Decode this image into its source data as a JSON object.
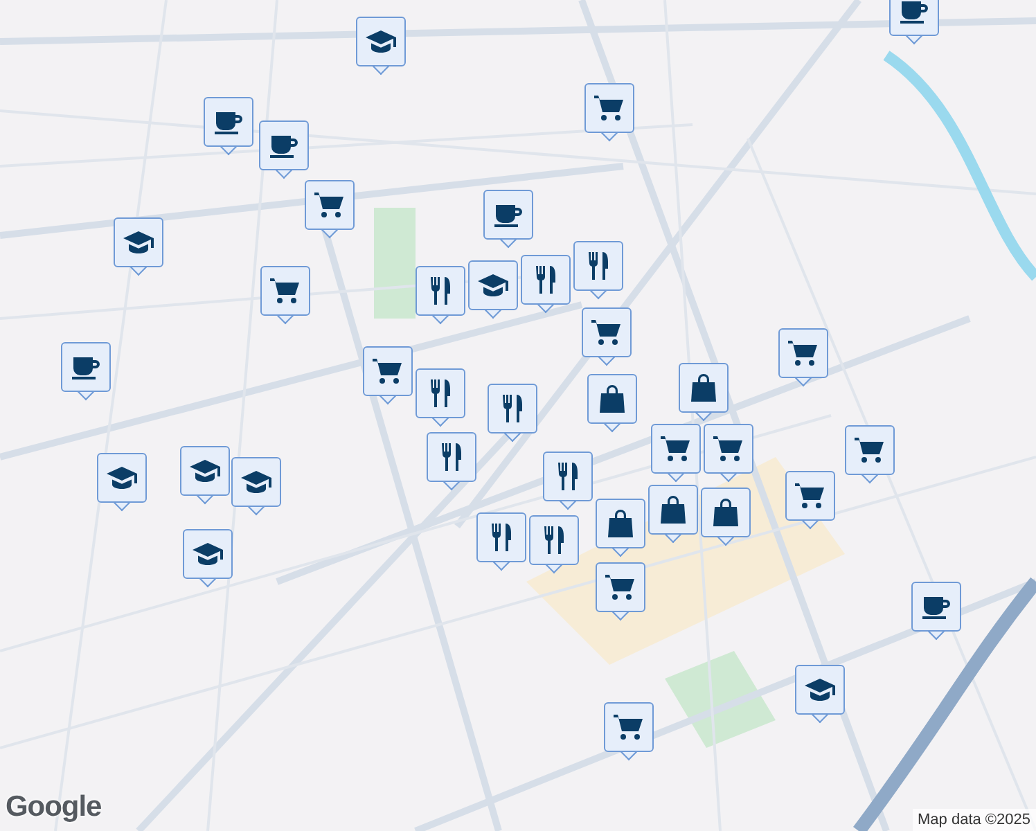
{
  "map": {
    "markers": [
      {
        "kind": "school"
      },
      {
        "kind": "cafe"
      },
      {
        "kind": "cart"
      },
      {
        "kind": "cafe"
      },
      {
        "kind": "cafe"
      },
      {
        "kind": "cart"
      },
      {
        "kind": "cafe"
      },
      {
        "kind": "school"
      },
      {
        "kind": "cart"
      },
      {
        "kind": "restaurant"
      },
      {
        "kind": "school"
      },
      {
        "kind": "restaurant"
      },
      {
        "kind": "restaurant"
      },
      {
        "kind": "cart"
      },
      {
        "kind": "cafe"
      },
      {
        "kind": "cart"
      },
      {
        "kind": "cart"
      },
      {
        "kind": "restaurant"
      },
      {
        "kind": "bag"
      },
      {
        "kind": "bag"
      },
      {
        "kind": "restaurant"
      },
      {
        "kind": "restaurant"
      },
      {
        "kind": "cart"
      },
      {
        "kind": "cart"
      },
      {
        "kind": "cart"
      },
      {
        "kind": "school"
      },
      {
        "kind": "school"
      },
      {
        "kind": "school"
      },
      {
        "kind": "restaurant"
      },
      {
        "kind": "bag"
      },
      {
        "kind": "bag"
      },
      {
        "kind": "cart"
      },
      {
        "kind": "restaurant"
      },
      {
        "kind": "bag"
      },
      {
        "kind": "restaurant"
      },
      {
        "kind": "school"
      },
      {
        "kind": "cart"
      },
      {
        "kind": "cafe"
      },
      {
        "kind": "school"
      },
      {
        "kind": "cart"
      }
    ]
  },
  "attribution": {
    "logo": "Google",
    "text": "Map data ©2025"
  }
}
